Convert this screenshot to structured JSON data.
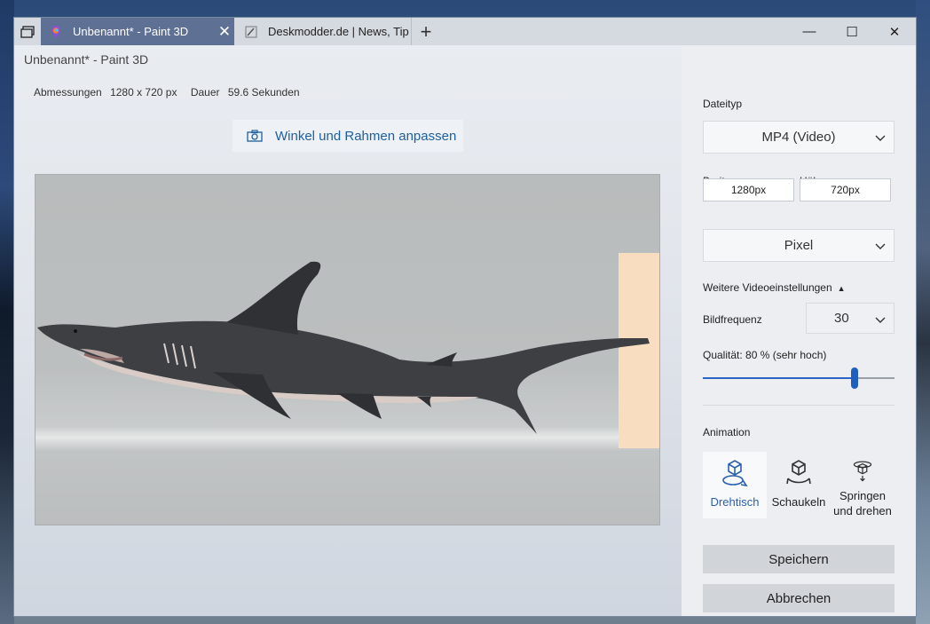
{
  "tabs": [
    {
      "label": "Unbenannt* - Paint 3D",
      "active": true
    },
    {
      "label": "Deskmodder.de | News, Tip",
      "active": false
    }
  ],
  "window": {
    "minimize": "—",
    "maximize": "☐",
    "close": "✕"
  },
  "app_title": "Unbenannt* - Paint 3D",
  "dims": {
    "dim_label": "Abmessungen",
    "dim_value": "1280 x 720 px",
    "dur_label": "Dauer",
    "dur_value": "59.6 Sekunden"
  },
  "adjust_label": "Winkel und Rahmen anpassen",
  "panel": {
    "filetype_label": "Dateityp",
    "filetype_value": "MP4 (Video)",
    "width_label": "Breite",
    "height_label": "Höhe",
    "width_value": "1280px",
    "height_value": "720px",
    "unit_value": "Pixel",
    "advanced_label": "Weitere Videoeinstellungen",
    "framerate_label": "Bildfrequenz",
    "framerate_value": "30",
    "quality_label": "Qualität: 80 % (sehr hoch)",
    "quality_fraction": 0.79,
    "animation_label": "Animation",
    "animations": [
      {
        "label": "Drehtisch",
        "selected": true
      },
      {
        "label": "Schaukeln",
        "selected": false
      },
      {
        "label": "Springen und drehen",
        "selected": false
      }
    ],
    "save_label": "Speichern",
    "cancel_label": "Abbrechen"
  },
  "colors": {
    "accent": "#1f5fbd",
    "tab_active": "#5e7194",
    "link": "#1f5fa0"
  }
}
